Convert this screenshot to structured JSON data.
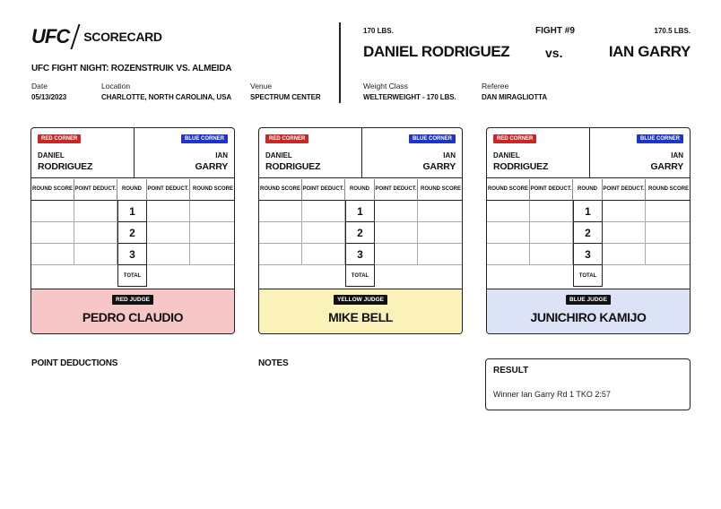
{
  "header": {
    "brand": "UFC",
    "title": "SCORECARD",
    "event": "UFC FIGHT NIGHT: ROZENSTRUIK VS. ALMEIDA",
    "date_label": "Date",
    "date": "05/13/2023",
    "location_label": "Location",
    "location": "CHARLOTTE, NORTH CAROLINA, USA",
    "venue_label": "Venue",
    "venue": "SPECTRUM CENTER",
    "weight_class_label": "Weight Class",
    "weight_class": "WELTERWEIGHT - 170 LBS.",
    "referee_label": "Referee",
    "referee": "DAN MIRAGLIOTTA"
  },
  "fight": {
    "number": "FIGHT #9",
    "vs": "vs.",
    "red": {
      "weight": "170 LBS.",
      "name": "DANIEL RODRIGUEZ",
      "first": "DANIEL",
      "last": "RODRIGUEZ"
    },
    "blue": {
      "weight": "170.5 LBS.",
      "name": "IAN GARRY",
      "first": "IAN",
      "last": "GARRY"
    }
  },
  "card_labels": {
    "red_corner": "RED CORNER",
    "blue_corner": "BLUE CORNER",
    "round_score": "ROUND SCORE",
    "point_deduct": "POINT DEDUCT.",
    "round": "ROUND",
    "total": "TOTAL",
    "rounds": [
      "1",
      "2",
      "3"
    ]
  },
  "judges": [
    {
      "tag": "RED JUDGE",
      "name": "PEDRO CLAUDIO",
      "color": "#f7c6c6"
    },
    {
      "tag": "YELLOW JUDGE",
      "name": "MIKE BELL",
      "color": "#fbf2b9"
    },
    {
      "tag": "BLUE JUDGE",
      "name": "JUNICHIRO KAMIJO",
      "color": "#dde3f7"
    }
  ],
  "sections": {
    "point_deductions": "POINT DEDUCTIONS",
    "notes": "NOTES",
    "result_title": "RESULT",
    "result_text": "Winner Ian Garry Rd 1 TKO 2:57"
  }
}
